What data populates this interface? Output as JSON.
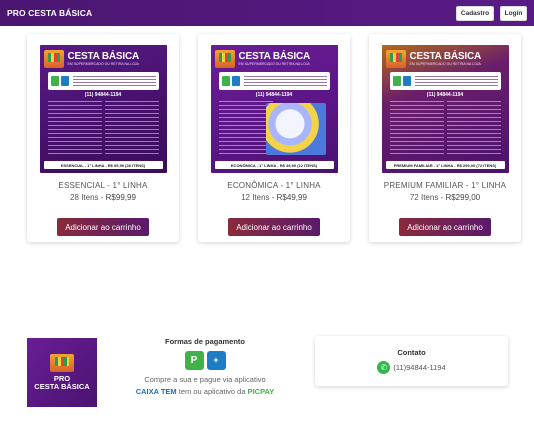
{
  "header": {
    "brand": "PRO CESTA BÁSICA",
    "register_label": "Cadastro",
    "login_label": "Login",
    "background": "#4a1670"
  },
  "products": [
    {
      "name": "ESSENCIAL - 1° LINHA",
      "items": "28 Itens",
      "price": "R$99,99",
      "button": "Adicionar ao carrinho",
      "image": {
        "title": "CESTA BÁSICA",
        "subtitle": "EM SUPERMERCADO OU RETIRA NA LOJA",
        "banner": "COMPRE A SUA E PAGUE VIA APLICATIVO CAIXA TEM OU APLICATIVO DA PICPAY",
        "phone": "(11) 94844-1194",
        "footer": "ESSENCIAL - 1° LINHA - R$ 99,99 (28 ITENS)"
      }
    },
    {
      "name": "ECONÔMICA - 1° LINHA",
      "items": "12 Itens",
      "price": "R$49,99",
      "button": "Adicionar ao carrinho",
      "image": {
        "title": "CESTA BÁSICA",
        "subtitle": "EM SUPERMERCADO OU RETIRA NA LOJA",
        "banner": "COMPRE A SUA E PAGUE VIA APLICATIVO CAIXA TEM OU APLICATIVO DA PICPAY",
        "phone": "(11) 94844-1194",
        "footer": "ECONÔMICA - 1° LINHA - R$ 49,99 (12 ITENS)"
      }
    },
    {
      "name": "PREMIUM FAMILIAR - 1° LINHA",
      "items": "72 Itens",
      "price": "R$299,00",
      "button": "Adicionar ao carrinho",
      "image": {
        "title": "CESTA BÁSICA",
        "subtitle": "EM SUPERMERCADO OU RETIRA NA LOJA",
        "banner": "COMPRE A SUA E PAGUE VIA APLICATIVO CAIXA TEM OU APLICATIVO DA PICPAY",
        "phone": "(11) 94844-1194",
        "footer": "PREMIUM FAMILIAR - 1° LINHA - R$ 299,00 (72 ITENS)"
      }
    }
  ],
  "footer": {
    "logo_text_top": "PRO",
    "logo_text_bottom": "CESTA BÁSICA",
    "payments_title": "Formas de pagamento",
    "payments_text": "Compre a sua e pague via aplicativo",
    "caixa_tem": "CAIXA TEM",
    "middle_text": "tem ou aplicativo da",
    "picpay": "PICPAY",
    "contact_title": "Contato",
    "contact_phone": "(11)94844-1194",
    "icons": [
      "pix-icon",
      "caixa-icon",
      "whatsapp-icon"
    ]
  },
  "colors": {
    "brand_purple": "#4a1670",
    "button_gradient_start": "#8a2a3c",
    "button_gradient_end": "#5a1a6a",
    "caixa_blue": "#1d6fb5",
    "picpay_green": "#3fb24a"
  }
}
